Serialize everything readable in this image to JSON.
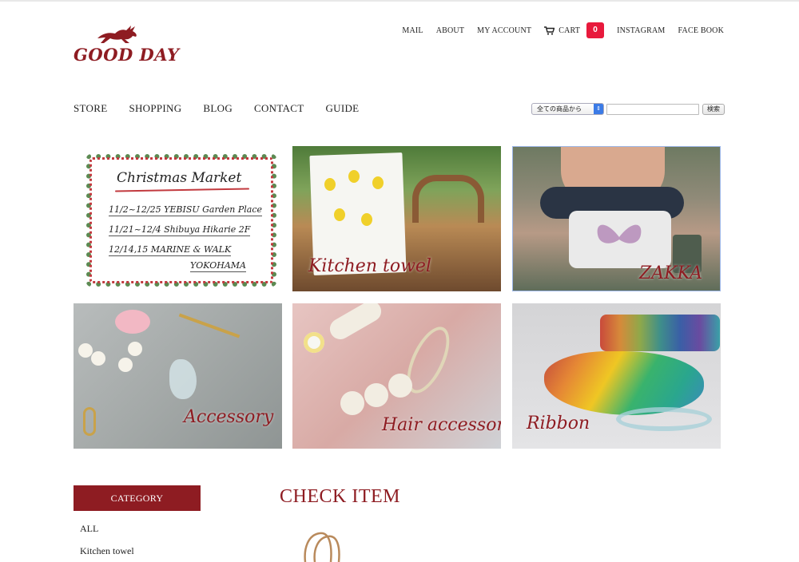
{
  "brand": {
    "name": "GOOD DAY",
    "color": "#8e1c22"
  },
  "util_links": [
    {
      "label": "MAIL"
    },
    {
      "label": "ABOUT"
    },
    {
      "label": "MY ACCOUNT"
    },
    {
      "label": "CART",
      "icon": "cart-icon",
      "count": "0"
    },
    {
      "label": "INSTAGRAM"
    },
    {
      "label": "FACE BOOK"
    }
  ],
  "nav": [
    "STORE",
    "SHOPPING",
    "BLOG",
    "CONTACT",
    "GUIDE"
  ],
  "search": {
    "select_value": "全ての商品から",
    "input_value": "",
    "button_label": "検索"
  },
  "featured": {
    "christmas": {
      "title": "Christmas Market",
      "lines": [
        "11/2~12/25 YEBISU Garden Place",
        "11/21~12/4 Shibuya Hikarie 2F",
        "12/14,15  MARINE & WALK",
        "YOKOHAMA"
      ]
    },
    "tiles": [
      {
        "caption": "Kitchen towel"
      },
      {
        "caption": "ZAKKA"
      },
      {
        "caption": "Accessory"
      },
      {
        "caption": "Hair accessory"
      },
      {
        "caption": "Ribbon"
      }
    ]
  },
  "sidebar": {
    "heading": "CATEGORY",
    "items": [
      "ALL",
      "Kitchen towel"
    ]
  },
  "main": {
    "heading": "CHECK ITEM"
  },
  "colors": {
    "accent": "#8e1c22",
    "badge": "#e8193c"
  }
}
